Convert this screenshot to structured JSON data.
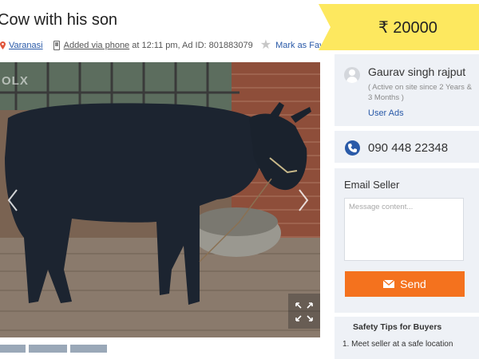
{
  "listing": {
    "title": "Cow with his son",
    "location": "Varanasi",
    "added_via": "Added via phone",
    "added_info": "at 12:11 pm, Ad ID: 801883079",
    "favorite_label": "Mark as Favorite"
  },
  "gallery": {
    "watermark": "OLX",
    "thumbnail_count": 3
  },
  "price": {
    "text": "₹ 20000",
    "tag_color": "#fde85f"
  },
  "seller": {
    "name": "Gaurav singh rajput",
    "active_since": "( Active on site since 2 Years & 3 Months )",
    "user_ads_label": "User Ads",
    "phone": "090 448 22348"
  },
  "email_seller": {
    "title": "Email Seller",
    "message_placeholder": "Message content...",
    "send_label": "Send",
    "send_color": "#f4721e"
  },
  "safety_tips": {
    "title": "Safety Tips for Buyers",
    "items": [
      "1.  Meet seller at a safe location"
    ]
  },
  "icons": [
    "location-pin-icon",
    "phone-device-icon",
    "star-icon",
    "chevron-left-icon",
    "chevron-right-icon",
    "expand-icon",
    "avatar-icon",
    "phone-icon",
    "envelope-icon"
  ]
}
